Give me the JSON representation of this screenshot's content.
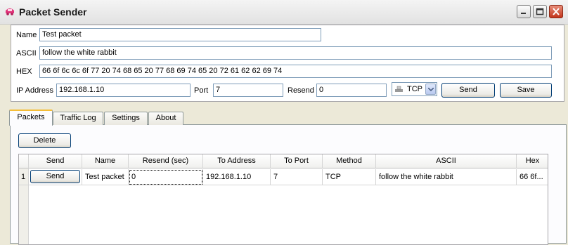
{
  "window": {
    "title": "Packet Sender"
  },
  "form": {
    "name_label": "Name",
    "name_value": "Test packet",
    "ascii_label": "ASCII",
    "ascii_value": "follow the white rabbit",
    "hex_label": "HEX",
    "hex_value": "66 6f 6c 6c 6f 77 20 74 68 65 20 77 68 69 74 65 20 72 61 62 62 69 74",
    "ip_label": "IP Address",
    "ip_value": "192.168.1.10",
    "port_label": "Port",
    "port_value": "7",
    "resend_label": "Resend",
    "resend_value": "0",
    "method_value": "TCP",
    "send_label": "Send",
    "save_label": "Save"
  },
  "tabs": [
    {
      "label": "Packets",
      "active": true
    },
    {
      "label": "Traffic Log",
      "active": false
    },
    {
      "label": "Settings",
      "active": false
    },
    {
      "label": "About",
      "active": false
    }
  ],
  "packets": {
    "delete_label": "Delete",
    "columns": [
      "Send",
      "Name",
      "Resend (sec)",
      "To Address",
      "To Port",
      "Method",
      "ASCII",
      "Hex"
    ],
    "rows": [
      {
        "num": "1",
        "send": "Send",
        "name": "Test packet",
        "resend": "0",
        "address": "192.168.1.10",
        "port": "7",
        "method": "TCP",
        "ascii": "follow the white rabbit",
        "hex": "66 6f..."
      }
    ]
  },
  "colors": {
    "tab_highlight": "#f5bd37",
    "button_border": "#003c74",
    "field_border": "#7f9db9"
  }
}
